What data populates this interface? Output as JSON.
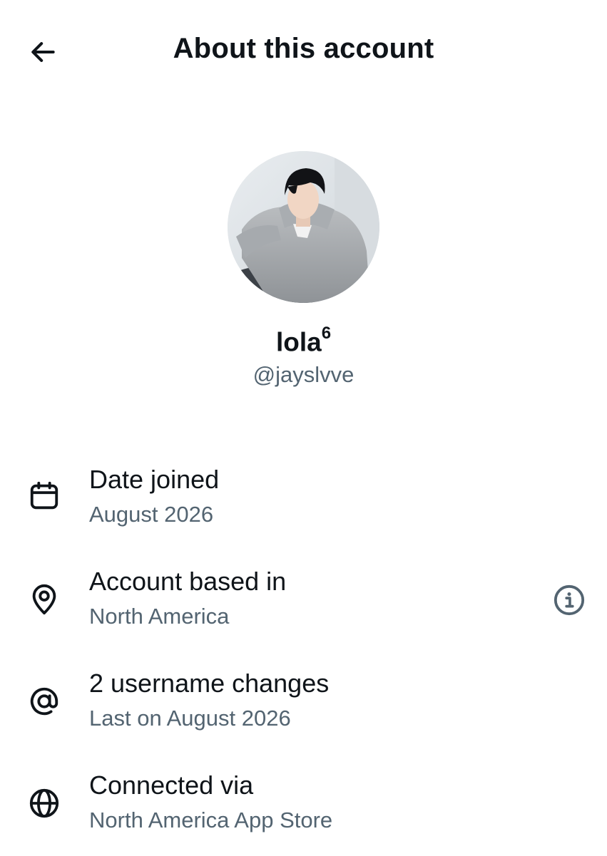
{
  "header": {
    "back_icon": "arrow-left-icon",
    "title": "About this account"
  },
  "profile": {
    "avatar_icon": "profile-photo",
    "display_name": "lola",
    "display_name_sup": "6",
    "handle": "@jayslvve"
  },
  "details": [
    {
      "icon": "calendar-icon",
      "title": "Date joined",
      "subtitle": "August 2026"
    },
    {
      "icon": "location-pin-icon",
      "title": "Account based in",
      "subtitle": "North America",
      "trailing_icon": "info-icon"
    },
    {
      "icon": "at-sign-icon",
      "title": "2 username changes",
      "subtitle": "Last on August 2026"
    },
    {
      "icon": "globe-icon",
      "title": "Connected via",
      "subtitle": "North America App Store"
    }
  ],
  "colors": {
    "text_primary": "#0f1419",
    "text_secondary": "#536471",
    "background": "#ffffff"
  }
}
